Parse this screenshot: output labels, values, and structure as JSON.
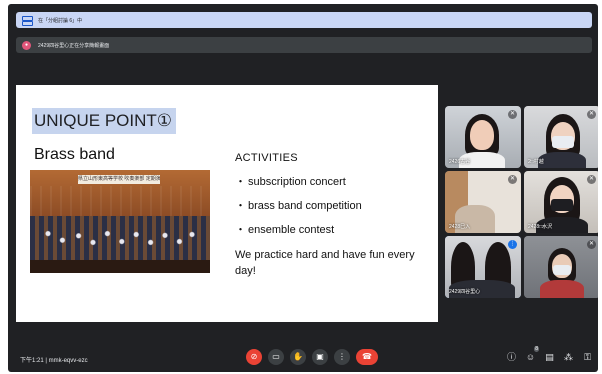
{
  "banners": {
    "pinned_text": "在「分組討論 6」中",
    "presenting_text": "2429四谷里心正在分享簡報畫面"
  },
  "slide": {
    "title": "UNIQUE POINT①",
    "subtitle": "Brass band",
    "photo_banner": "県立山形東高等学校 吹奏楽部 定期演奏会",
    "activities_label": "ACTIVITIES",
    "activities": [
      "subscription concert",
      "brass band competition",
      "ensemble contest"
    ],
    "note": "We practice hard and have fun every day!"
  },
  "participants": [
    {
      "name": "2426古谷"
    },
    {
      "name": "2□村越"
    },
    {
      "name": "2428巳入"
    },
    {
      "name": "2428□水沢"
    },
    {
      "name": "2429四谷里心"
    },
    {
      "name": ""
    }
  ],
  "footer": {
    "time": "下午1:21",
    "separator": "|",
    "meeting_code": "mmk-eqvv-ezc",
    "people_count": "8"
  },
  "icons": {
    "pin": "pin-icon",
    "mic_off": "mic-off-icon",
    "camera": "camera-icon",
    "raise_hand": "raise-hand-icon",
    "present": "present-icon",
    "more": "more-options-icon",
    "end_call": "end-call-icon",
    "info": "info-icon",
    "people": "people-icon",
    "chat": "chat-icon",
    "activities": "activities-icon",
    "host_controls": "host-controls-icon"
  },
  "colors": {
    "meet_background": "#202124",
    "pinned_banner": "#c9d6f5",
    "title_highlight": "#c6d4ee",
    "control_red": "#ea4335",
    "speaking_border": "#8ab4f8"
  }
}
